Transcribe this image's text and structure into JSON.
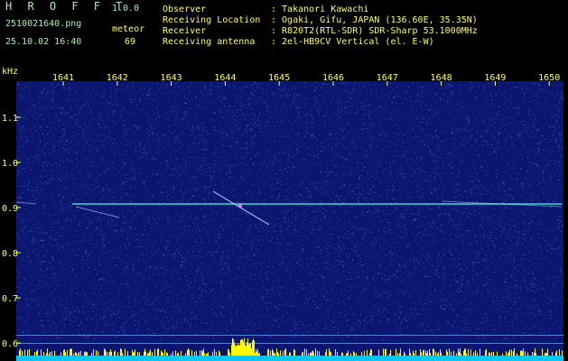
{
  "header": {
    "app_name": "H R O F F T",
    "version": "1.0.0",
    "file_name": "2510021640.png",
    "datetime": "25.10.02 16:40",
    "detection_type": "meteor",
    "count": "69"
  },
  "info": [
    {
      "label": "Observer",
      "value": ": Takanori Kawachi"
    },
    {
      "label": "Receiving Location",
      "value": ": Ogaki, Gifu, JAPAN (136.60E, 35.35N)"
    },
    {
      "label": "Receiver",
      "value": ": R820T2(RTL-SDR) SDR-Sharp 53.1000MHz"
    },
    {
      "label": "Receiving antenna",
      "value": ": 2el-HB9CV Vertical (el. E-W)"
    }
  ],
  "spectrogram": {
    "y_unit": "kHz",
    "x_ticks": [
      "1641",
      "1642",
      "1643",
      "1644",
      "1645",
      "1646",
      "1647",
      "1648",
      "1649",
      "1650"
    ],
    "y_ticks": [
      "1.1",
      "1.0",
      "0.9",
      "0.8",
      "0.7",
      "0.6"
    ],
    "colors": {
      "background": "#0a1670",
      "noise": "#3b5cc8",
      "carrier": "#40ffe0",
      "echo": "#c0d8ff",
      "axis_text": "#ffff66",
      "level_bars": "#ffff00",
      "baseline": "#00c8ff"
    }
  }
}
